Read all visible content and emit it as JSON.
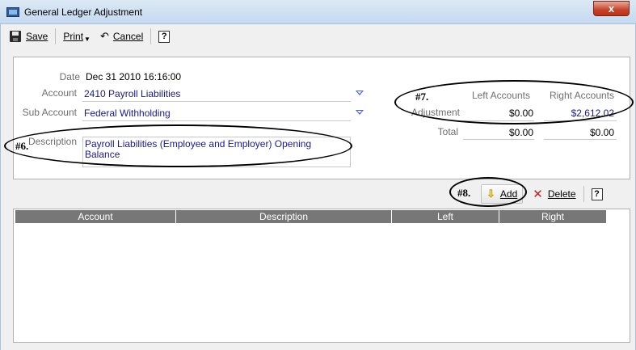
{
  "window": {
    "title": "General Ledger Adjustment",
    "close_glyph": "x"
  },
  "toolbar": {
    "save_label": "Save",
    "print_label": "Print",
    "cancel_label": "Cancel",
    "help_label": "?"
  },
  "form": {
    "date_label": "Date",
    "date_value": "Dec 31 2010 16:16:00",
    "account_label": "Account",
    "account_value": "2410 Payroll Liabilities",
    "sub_account_label": "Sub Account",
    "sub_account_value": "Federal Withholding",
    "description_label": "Description",
    "description_value": "Payroll Liabilities (Employee and Employer) Opening Balance"
  },
  "totals": {
    "left_header": "Left Accounts",
    "right_header": "Right Accounts",
    "adjustment_label": "Adjustment",
    "adjustment_left": "$0.00",
    "adjustment_right": "$2,612.02",
    "total_label": "Total",
    "total_left": "$0.00",
    "total_right": "$0.00"
  },
  "callouts": {
    "c6": "#6.",
    "c7": "#7.",
    "c8": "#8."
  },
  "actions": {
    "add_label": "Add",
    "delete_label": "Delete",
    "help_label": "?"
  },
  "grid": {
    "columns": [
      "Account",
      "Description",
      "Left",
      "Right"
    ],
    "rows": []
  },
  "colors": {
    "link_text": "#1a1a8a",
    "header_bg": "#777777",
    "title_bar": "#c6d9ef",
    "close_button": "#c9432b"
  }
}
